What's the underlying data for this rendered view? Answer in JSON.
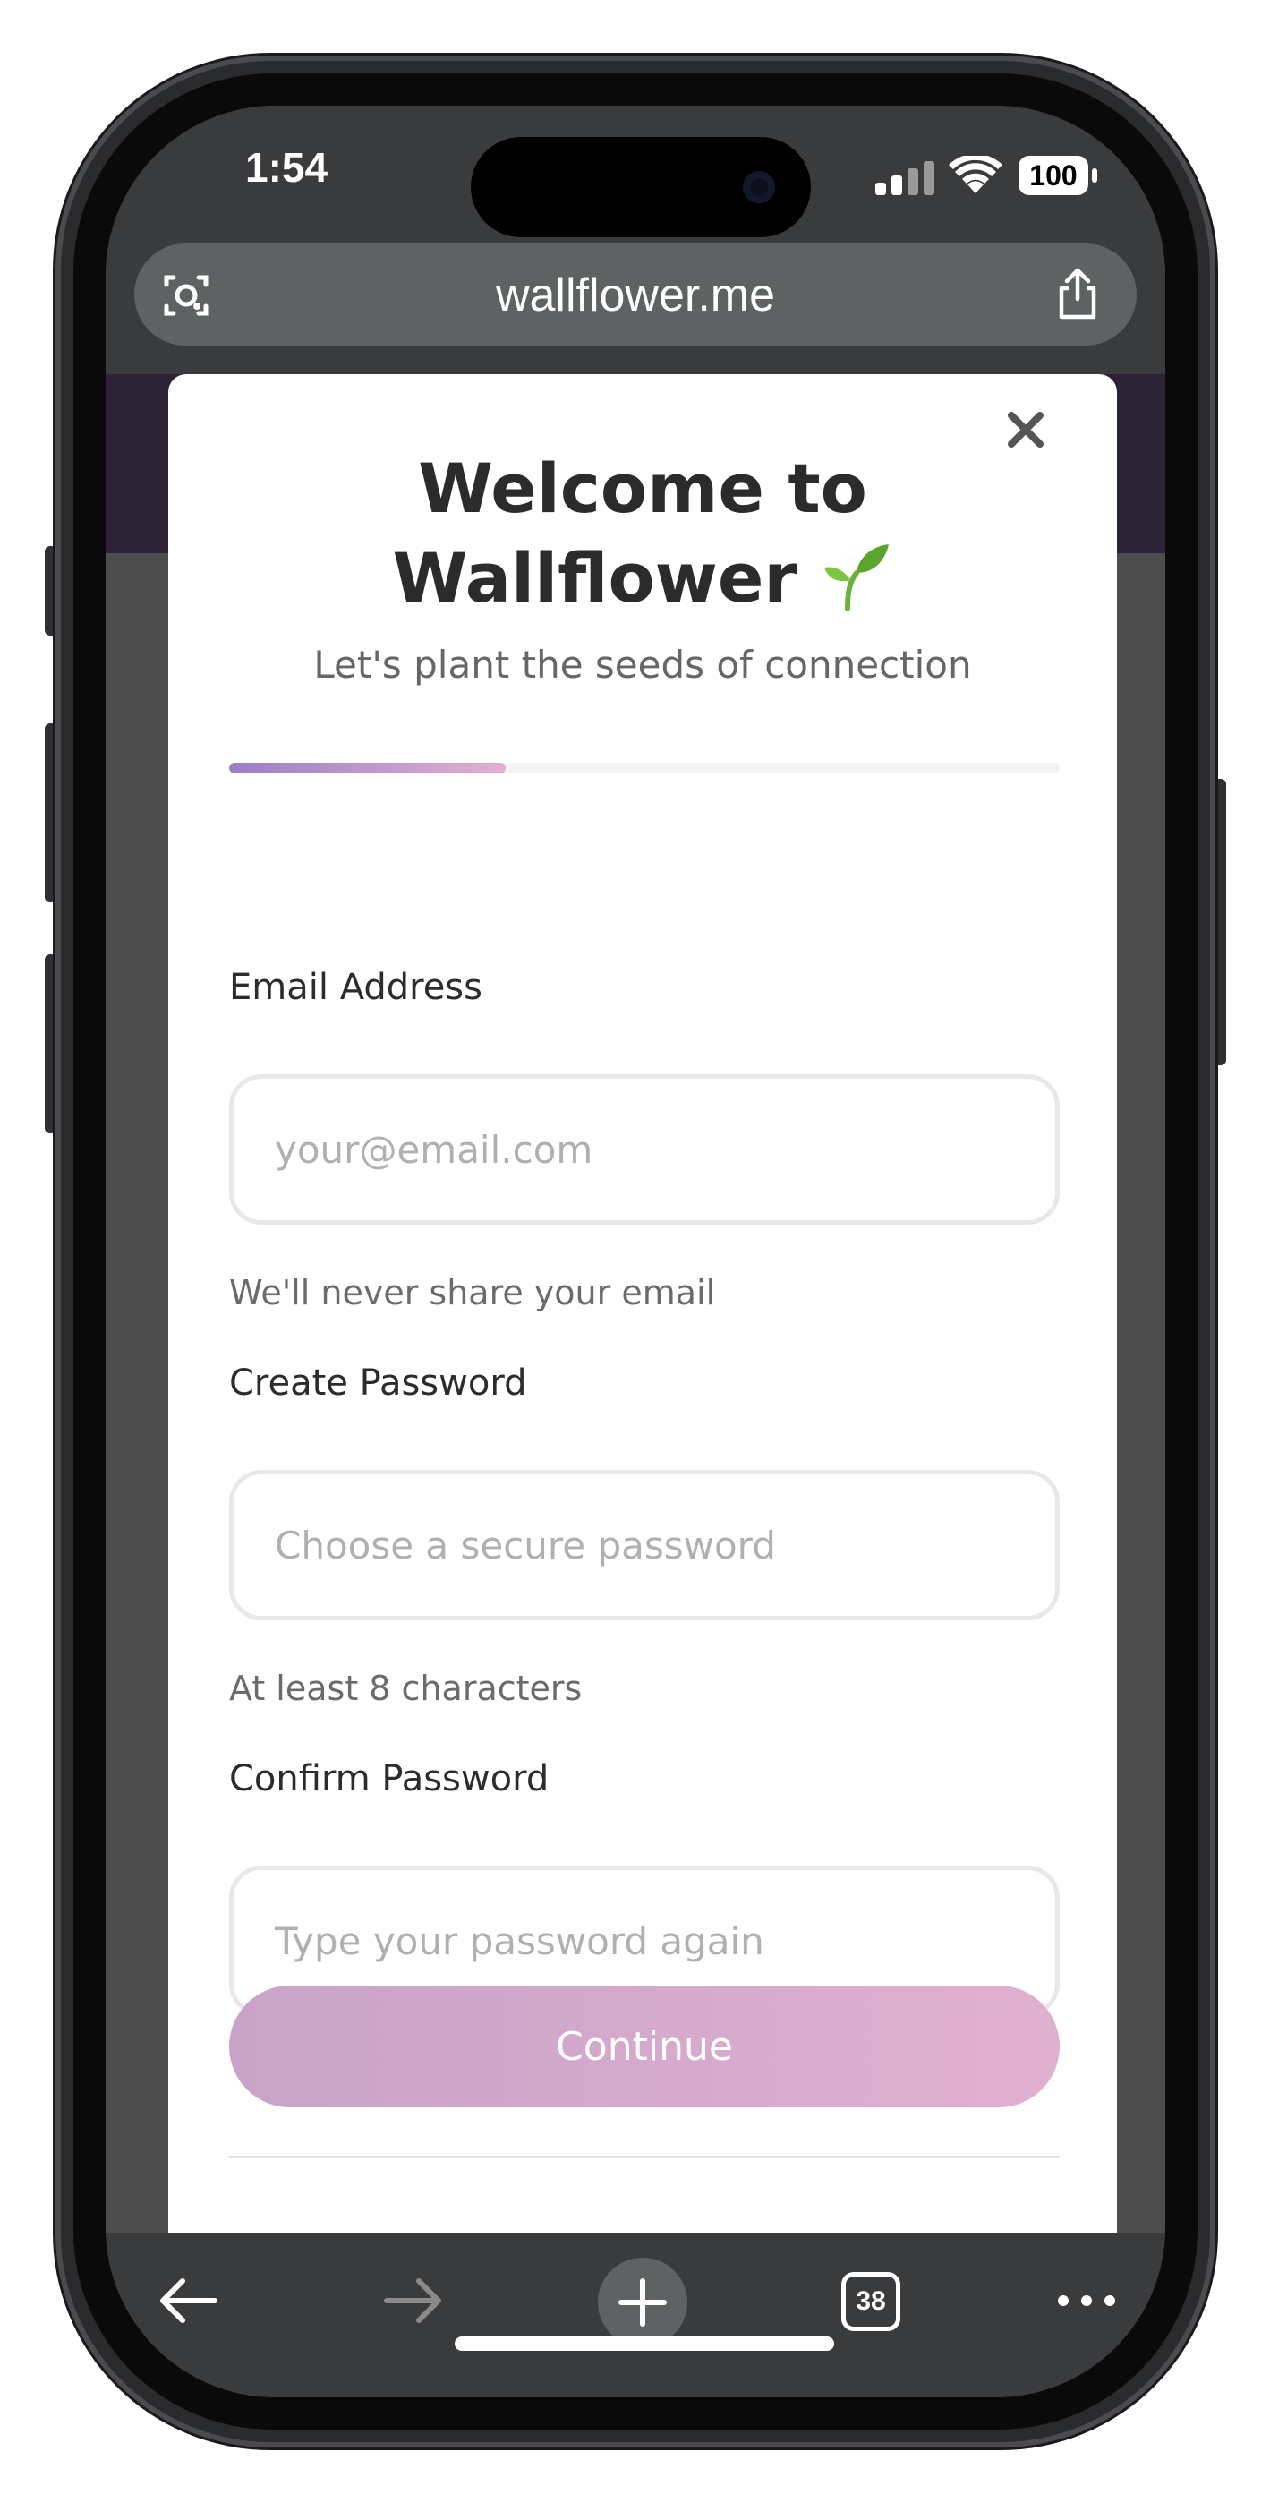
{
  "status_bar": {
    "time": "1:54",
    "battery": "100"
  },
  "browser": {
    "url": "wallflower.me",
    "tabs_count": "38",
    "icons": [
      "camera-search-icon",
      "share-icon",
      "back-arrow-icon",
      "forward-arrow-icon",
      "plus-icon",
      "tabs-icon",
      "more-icon"
    ]
  },
  "modal": {
    "title_line1": "Welcome to",
    "title_line2": "Wallflower",
    "title_emoji_icon": "seedling-icon",
    "subtitle": "Let's plant the seeds of connection",
    "progress": 0.333,
    "progress_colors": [
      "#9a7fc6",
      "#e3b0d2"
    ],
    "email": {
      "label": "Email Address",
      "placeholder": "your@email.com",
      "value": "",
      "hint": "We'll never share your email"
    },
    "password": {
      "label": "Create Password",
      "placeholder": "Choose a secure password",
      "value": "",
      "hint": "At least 8 characters"
    },
    "confirm_password": {
      "label": "Confirm Password",
      "placeholder": "Type your password again",
      "value": ""
    },
    "continue_label": "Continue"
  },
  "colors": {
    "accent_gradient_start": "#c9a3c9",
    "accent_gradient_end": "#e0b0cf",
    "header_dark": "#2b2236"
  }
}
